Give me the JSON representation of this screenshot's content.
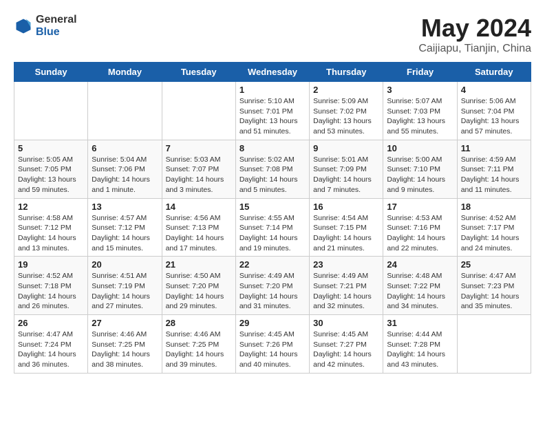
{
  "header": {
    "logo_general": "General",
    "logo_blue": "Blue",
    "title": "May 2024",
    "location": "Caijiapu, Tianjin, China"
  },
  "weekdays": [
    "Sunday",
    "Monday",
    "Tuesday",
    "Wednesday",
    "Thursday",
    "Friday",
    "Saturday"
  ],
  "weeks": [
    [
      {
        "day": "",
        "info": ""
      },
      {
        "day": "",
        "info": ""
      },
      {
        "day": "",
        "info": ""
      },
      {
        "day": "1",
        "info": "Sunrise: 5:10 AM\nSunset: 7:01 PM\nDaylight: 13 hours\nand 51 minutes."
      },
      {
        "day": "2",
        "info": "Sunrise: 5:09 AM\nSunset: 7:02 PM\nDaylight: 13 hours\nand 53 minutes."
      },
      {
        "day": "3",
        "info": "Sunrise: 5:07 AM\nSunset: 7:03 PM\nDaylight: 13 hours\nand 55 minutes."
      },
      {
        "day": "4",
        "info": "Sunrise: 5:06 AM\nSunset: 7:04 PM\nDaylight: 13 hours\nand 57 minutes."
      }
    ],
    [
      {
        "day": "5",
        "info": "Sunrise: 5:05 AM\nSunset: 7:05 PM\nDaylight: 13 hours\nand 59 minutes."
      },
      {
        "day": "6",
        "info": "Sunrise: 5:04 AM\nSunset: 7:06 PM\nDaylight: 14 hours\nand 1 minute."
      },
      {
        "day": "7",
        "info": "Sunrise: 5:03 AM\nSunset: 7:07 PM\nDaylight: 14 hours\nand 3 minutes."
      },
      {
        "day": "8",
        "info": "Sunrise: 5:02 AM\nSunset: 7:08 PM\nDaylight: 14 hours\nand 5 minutes."
      },
      {
        "day": "9",
        "info": "Sunrise: 5:01 AM\nSunset: 7:09 PM\nDaylight: 14 hours\nand 7 minutes."
      },
      {
        "day": "10",
        "info": "Sunrise: 5:00 AM\nSunset: 7:10 PM\nDaylight: 14 hours\nand 9 minutes."
      },
      {
        "day": "11",
        "info": "Sunrise: 4:59 AM\nSunset: 7:11 PM\nDaylight: 14 hours\nand 11 minutes."
      }
    ],
    [
      {
        "day": "12",
        "info": "Sunrise: 4:58 AM\nSunset: 7:12 PM\nDaylight: 14 hours\nand 13 minutes."
      },
      {
        "day": "13",
        "info": "Sunrise: 4:57 AM\nSunset: 7:12 PM\nDaylight: 14 hours\nand 15 minutes."
      },
      {
        "day": "14",
        "info": "Sunrise: 4:56 AM\nSunset: 7:13 PM\nDaylight: 14 hours\nand 17 minutes."
      },
      {
        "day": "15",
        "info": "Sunrise: 4:55 AM\nSunset: 7:14 PM\nDaylight: 14 hours\nand 19 minutes."
      },
      {
        "day": "16",
        "info": "Sunrise: 4:54 AM\nSunset: 7:15 PM\nDaylight: 14 hours\nand 21 minutes."
      },
      {
        "day": "17",
        "info": "Sunrise: 4:53 AM\nSunset: 7:16 PM\nDaylight: 14 hours\nand 22 minutes."
      },
      {
        "day": "18",
        "info": "Sunrise: 4:52 AM\nSunset: 7:17 PM\nDaylight: 14 hours\nand 24 minutes."
      }
    ],
    [
      {
        "day": "19",
        "info": "Sunrise: 4:52 AM\nSunset: 7:18 PM\nDaylight: 14 hours\nand 26 minutes."
      },
      {
        "day": "20",
        "info": "Sunrise: 4:51 AM\nSunset: 7:19 PM\nDaylight: 14 hours\nand 27 minutes."
      },
      {
        "day": "21",
        "info": "Sunrise: 4:50 AM\nSunset: 7:20 PM\nDaylight: 14 hours\nand 29 minutes."
      },
      {
        "day": "22",
        "info": "Sunrise: 4:49 AM\nSunset: 7:20 PM\nDaylight: 14 hours\nand 31 minutes."
      },
      {
        "day": "23",
        "info": "Sunrise: 4:49 AM\nSunset: 7:21 PM\nDaylight: 14 hours\nand 32 minutes."
      },
      {
        "day": "24",
        "info": "Sunrise: 4:48 AM\nSunset: 7:22 PM\nDaylight: 14 hours\nand 34 minutes."
      },
      {
        "day": "25",
        "info": "Sunrise: 4:47 AM\nSunset: 7:23 PM\nDaylight: 14 hours\nand 35 minutes."
      }
    ],
    [
      {
        "day": "26",
        "info": "Sunrise: 4:47 AM\nSunset: 7:24 PM\nDaylight: 14 hours\nand 36 minutes."
      },
      {
        "day": "27",
        "info": "Sunrise: 4:46 AM\nSunset: 7:25 PM\nDaylight: 14 hours\nand 38 minutes."
      },
      {
        "day": "28",
        "info": "Sunrise: 4:46 AM\nSunset: 7:25 PM\nDaylight: 14 hours\nand 39 minutes."
      },
      {
        "day": "29",
        "info": "Sunrise: 4:45 AM\nSunset: 7:26 PM\nDaylight: 14 hours\nand 40 minutes."
      },
      {
        "day": "30",
        "info": "Sunrise: 4:45 AM\nSunset: 7:27 PM\nDaylight: 14 hours\nand 42 minutes."
      },
      {
        "day": "31",
        "info": "Sunrise: 4:44 AM\nSunset: 7:28 PM\nDaylight: 14 hours\nand 43 minutes."
      },
      {
        "day": "",
        "info": ""
      }
    ]
  ]
}
